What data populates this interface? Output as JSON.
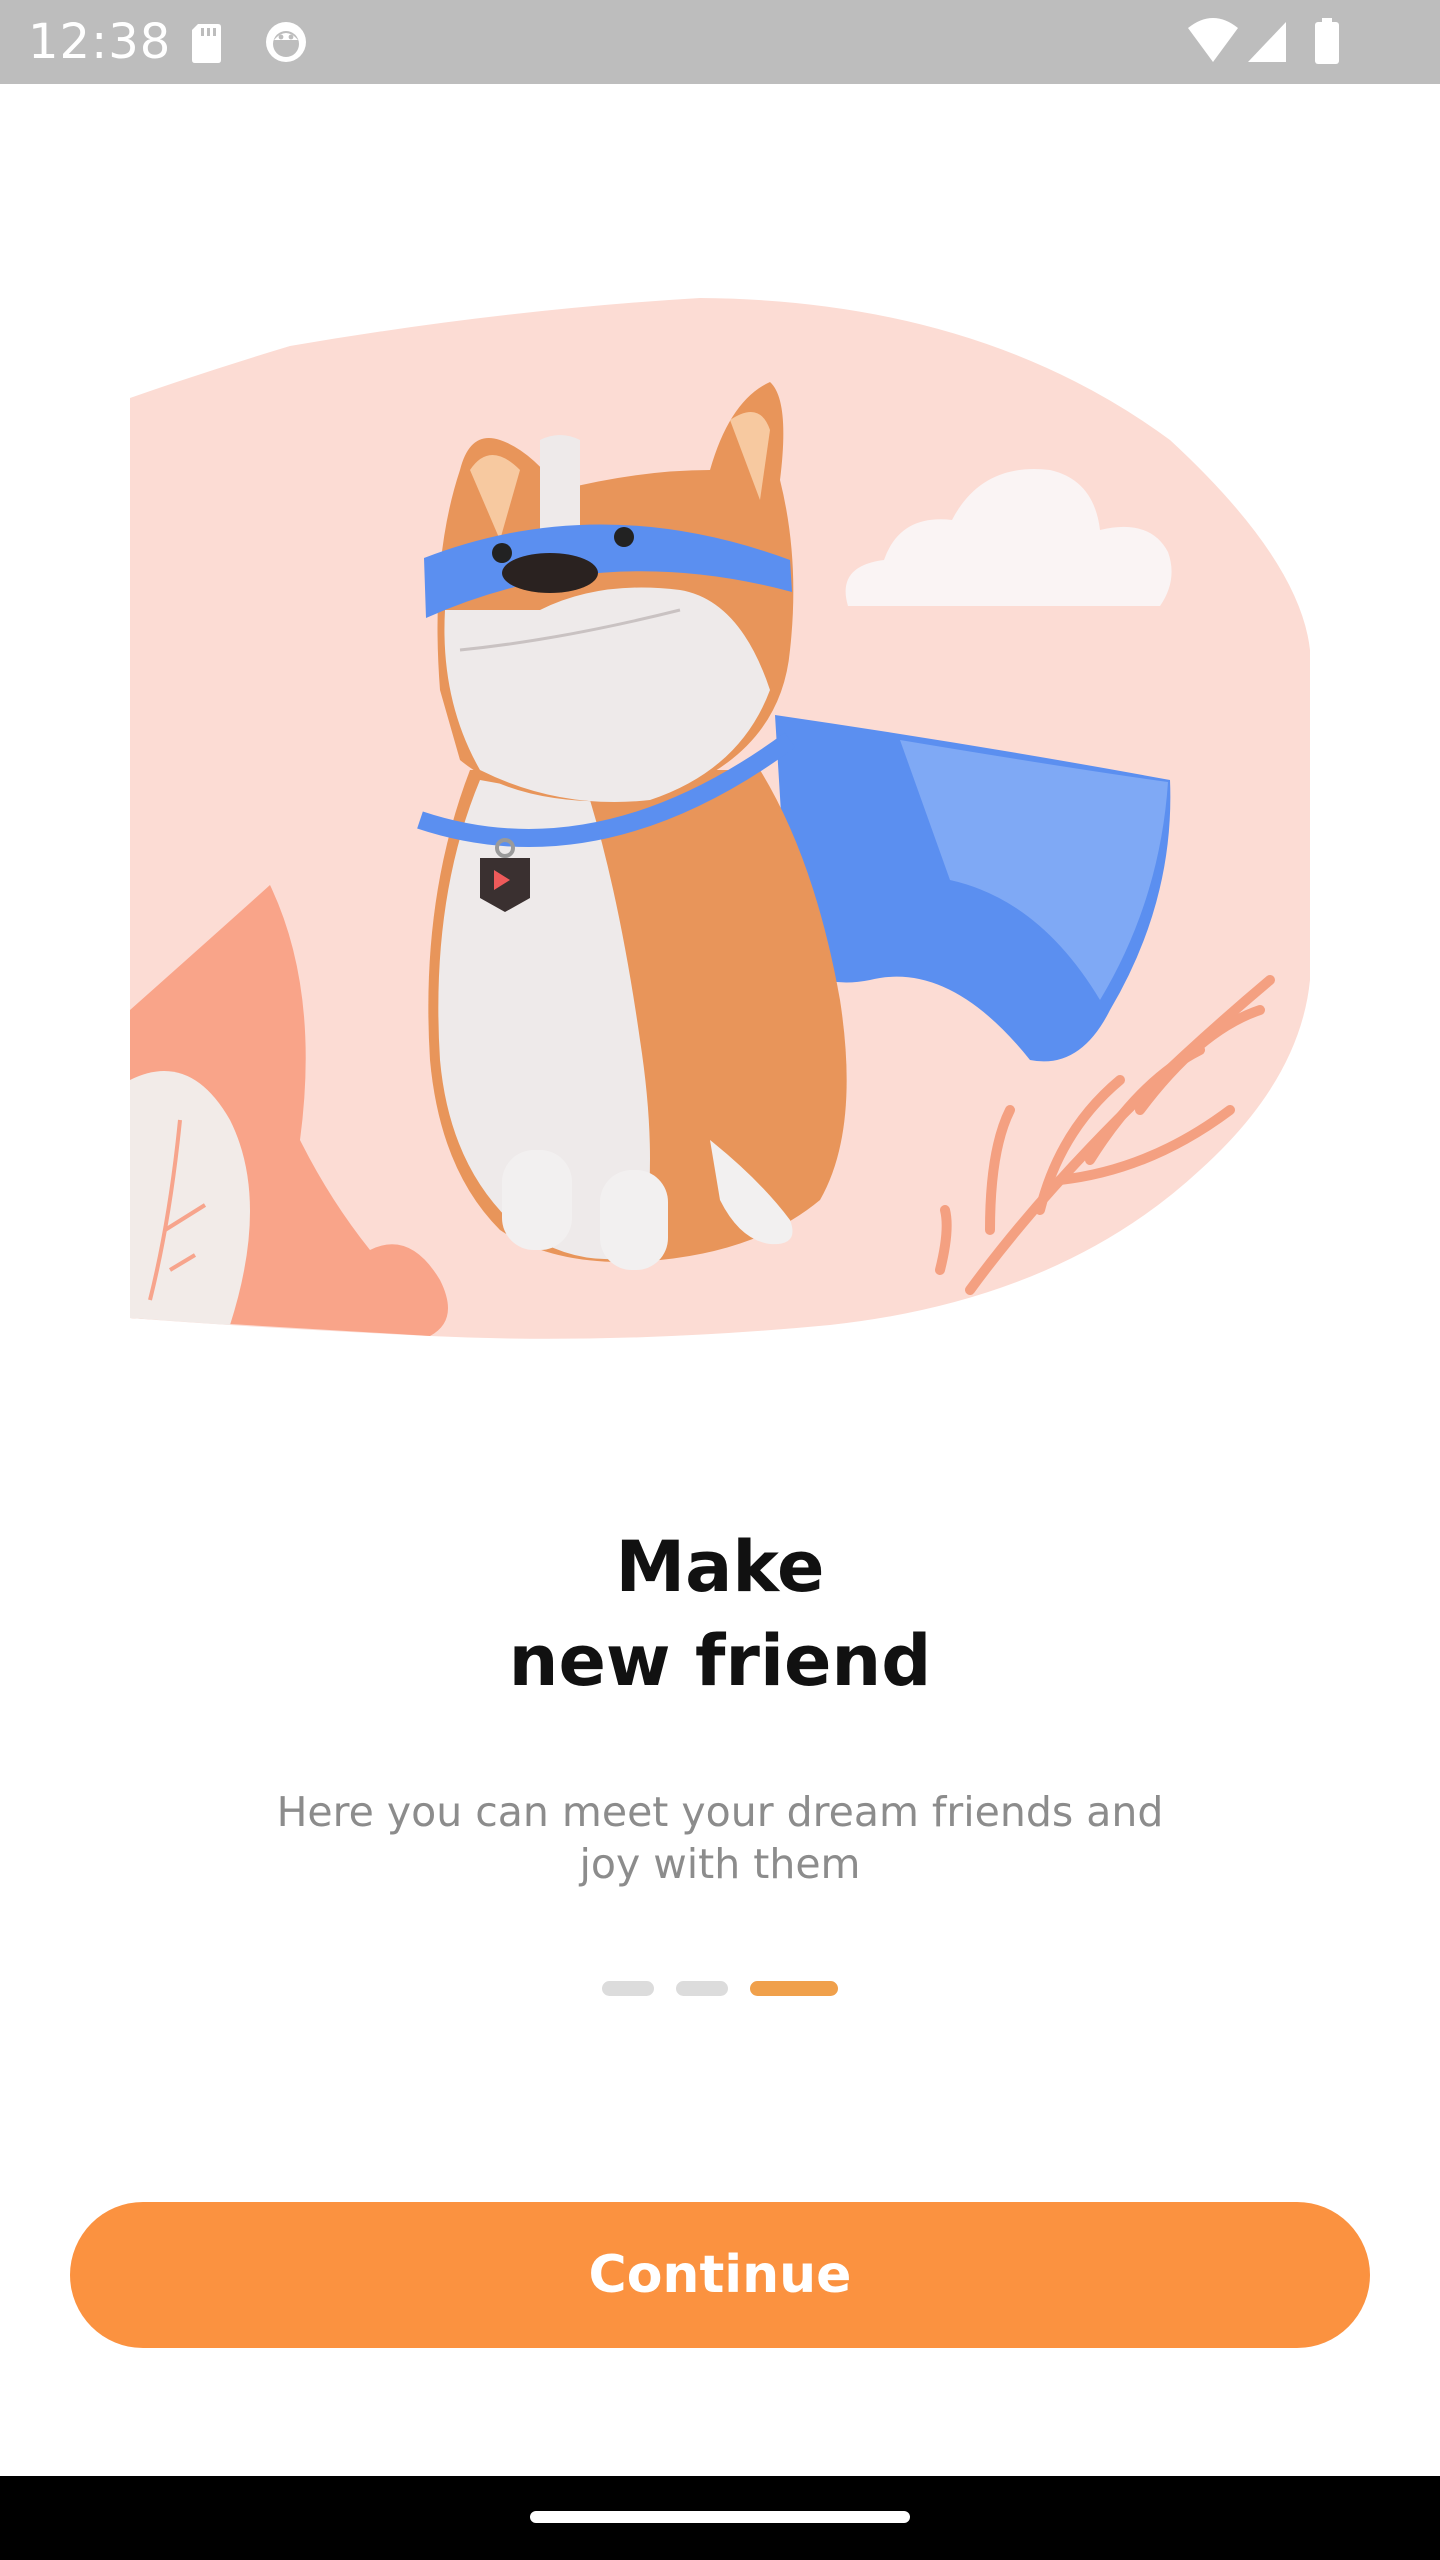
{
  "status_bar": {
    "time": "12:38",
    "left_icons": [
      "sd-card-icon",
      "android-debug-icon"
    ],
    "right_icons": [
      "wifi-icon",
      "cellular-signal-icon",
      "battery-icon"
    ]
  },
  "onboarding": {
    "illustration": "superhero-dog-illustration",
    "title": "Make\nnew friend",
    "subtitle": "Here you can meet your dream friends and joy with them",
    "pager": {
      "total": 3,
      "active_index": 3
    },
    "continue_label": "Continue"
  },
  "colors": {
    "accent": "#fb9240",
    "pager_active": "#f0a04b",
    "pager_inactive": "#dcdcdc",
    "hero_background": "#fcdcd4",
    "cape_blue": "#5b8ff0"
  }
}
